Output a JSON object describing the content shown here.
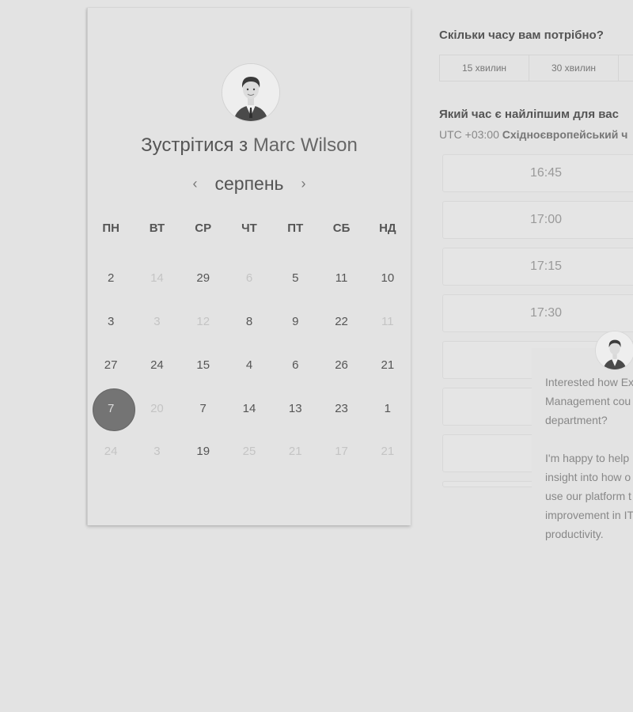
{
  "calendar": {
    "title_prefix": "Зустрітися з",
    "host": "Marc Wilson",
    "month": "серпень",
    "prev_icon": "chevron-left-icon",
    "next_icon": "chevron-right-icon",
    "weekdays": [
      "ПН",
      "ВТ",
      "СР",
      "ЧТ",
      "ПТ",
      "СБ",
      "НД"
    ],
    "weeks": [
      [
        {
          "d": "2",
          "f": false
        },
        {
          "d": "14",
          "f": true
        },
        {
          "d": "29",
          "f": false
        },
        {
          "d": "6",
          "f": true
        },
        {
          "d": "5",
          "f": false
        },
        {
          "d": "11",
          "f": false
        },
        {
          "d": "10",
          "f": false
        }
      ],
      [
        {
          "d": "3",
          "f": false
        },
        {
          "d": "3",
          "f": true
        },
        {
          "d": "12",
          "f": true
        },
        {
          "d": "8",
          "f": false
        },
        {
          "d": "9",
          "f": false
        },
        {
          "d": "22",
          "f": false
        },
        {
          "d": "11",
          "f": true
        }
      ],
      [
        {
          "d": "27",
          "f": false
        },
        {
          "d": "24",
          "f": false
        },
        {
          "d": "15",
          "f": false
        },
        {
          "d": "4",
          "f": false
        },
        {
          "d": "6",
          "f": false
        },
        {
          "d": "26",
          "f": false
        },
        {
          "d": "21",
          "f": false
        }
      ],
      [
        {
          "d": "7",
          "f": false,
          "selected": true
        },
        {
          "d": "20",
          "f": true
        },
        {
          "d": "7",
          "f": false
        },
        {
          "d": "14",
          "f": false
        },
        {
          "d": "13",
          "f": false
        },
        {
          "d": "23",
          "f": false
        },
        {
          "d": "1",
          "f": false
        }
      ],
      [
        {
          "d": "24",
          "f": true
        },
        {
          "d": "3",
          "f": true
        },
        {
          "d": "19",
          "f": false
        },
        {
          "d": "25",
          "f": true
        },
        {
          "d": "21",
          "f": true
        },
        {
          "d": "17",
          "f": true
        },
        {
          "d": "21",
          "f": true
        }
      ]
    ]
  },
  "booking": {
    "duration_question": "Скільки часу вам потрібно?",
    "durations": [
      "15 хвилин",
      "30 хвилин"
    ],
    "time_question": "Який час є найліпшим для вас",
    "tz_offset": "UTC +03:00",
    "tz_name": "Східноєвропейський ч",
    "slots": [
      "16:45",
      "17:00",
      "17:15",
      "17:30",
      "",
      "",
      "",
      ""
    ]
  },
  "chat": {
    "line1": "Interested how Ex",
    "line2": "Management cou",
    "line3": "department?",
    "line4": "I'm happy to help",
    "line5": "insight into how o",
    "line6": "use our platform t",
    "line7": "improvement in IT",
    "line8": "productivity."
  }
}
